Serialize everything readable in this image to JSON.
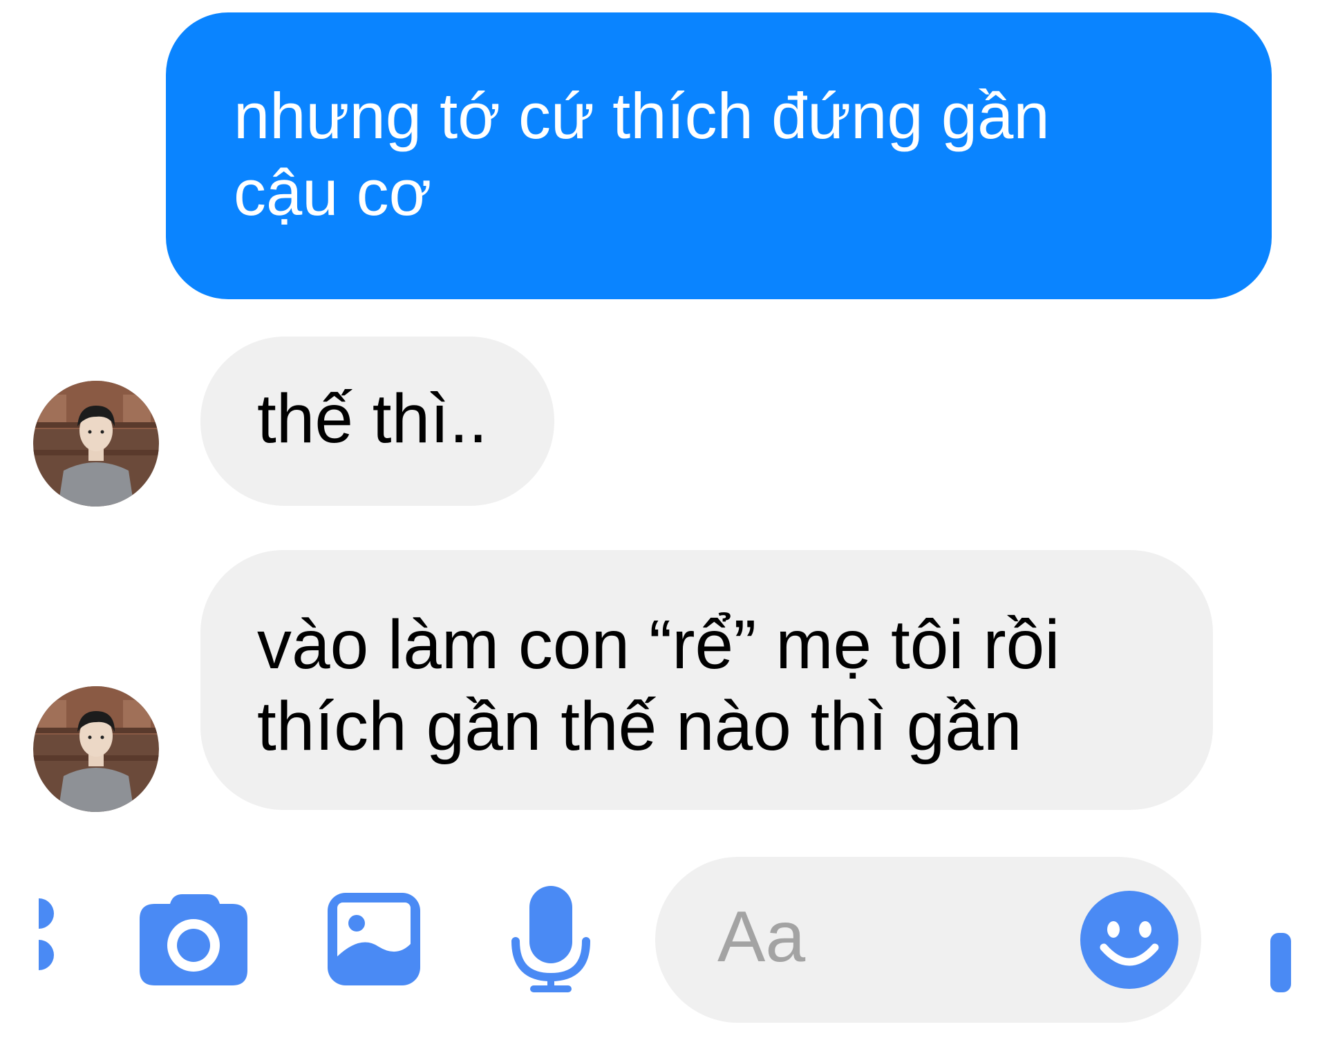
{
  "conversation": {
    "messages": [
      {
        "sender": "me",
        "lines": [
          "nhưng tớ cứ thích đứng gần",
          "cậu cơ"
        ]
      },
      {
        "sender": "other",
        "lines": [
          "thế thì.."
        ]
      },
      {
        "sender": "other",
        "lines": [
          "vào làm con “rể” mẹ tôi rồi",
          "thích gần thế nào thì gần"
        ]
      }
    ]
  },
  "composer": {
    "placeholder": "Aa",
    "icons": [
      "more-icon",
      "camera-icon",
      "image-icon",
      "microphone-icon",
      "emoji-icon"
    ]
  },
  "colors": {
    "accent": "#0a84ff",
    "icon": "#4a8af4",
    "incoming_bubble": "#f0f0f0",
    "outgoing_text": "#ffffff",
    "placeholder": "#a3a3a3"
  }
}
